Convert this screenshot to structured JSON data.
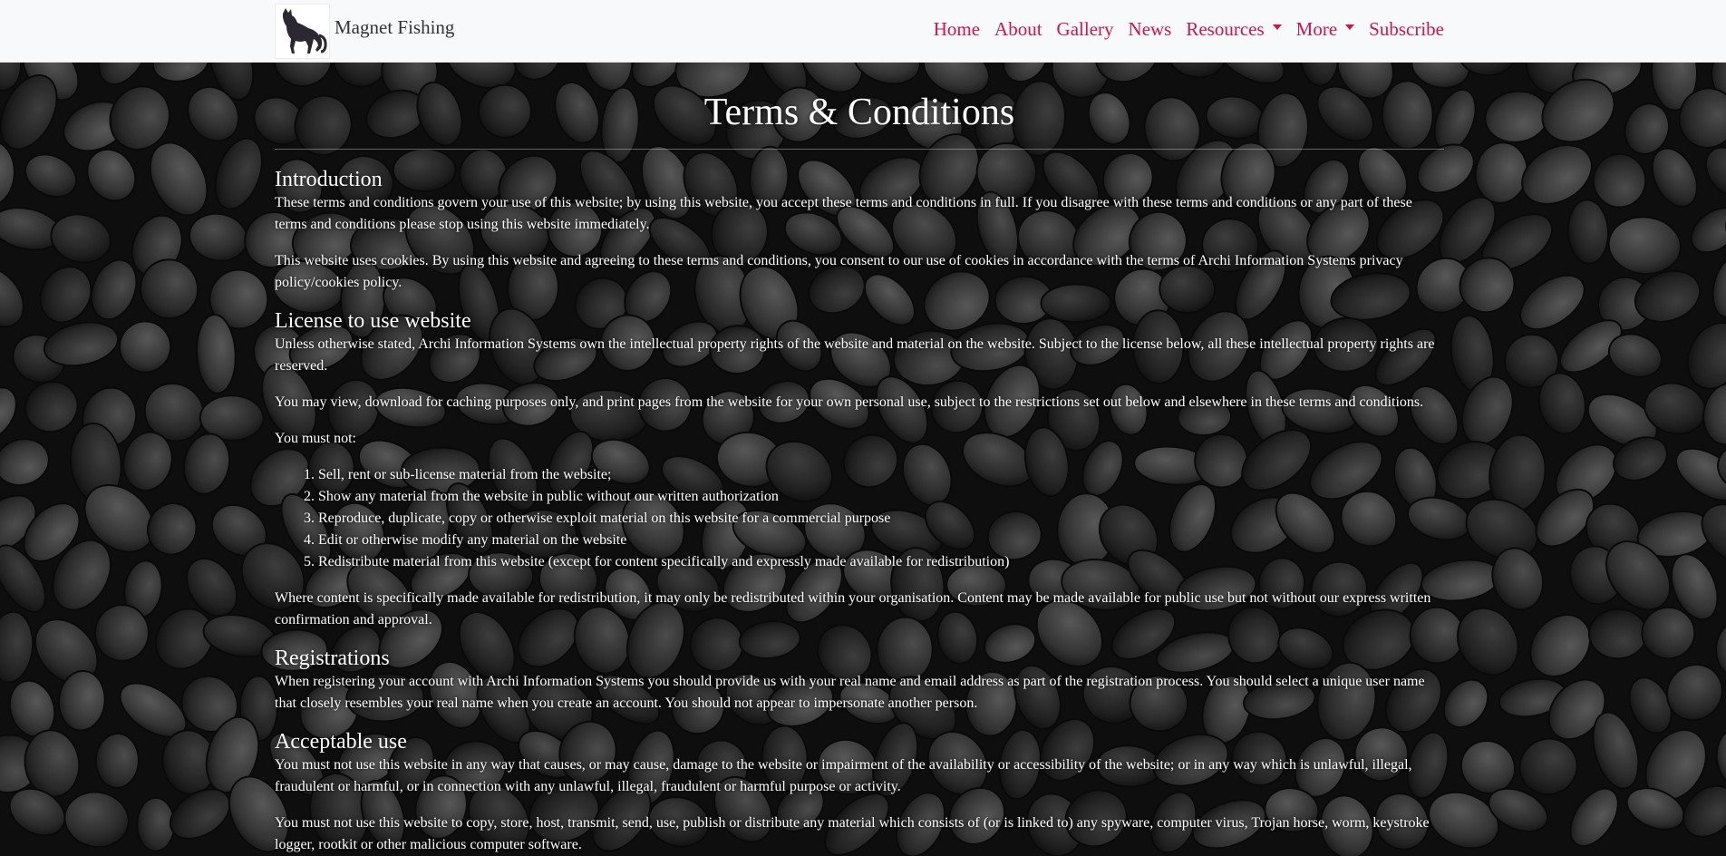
{
  "brand": {
    "name": "Magnet Fishing"
  },
  "nav": {
    "items": [
      {
        "label": "Home"
      },
      {
        "label": "About"
      },
      {
        "label": "Gallery"
      },
      {
        "label": "News"
      },
      {
        "label": "Resources",
        "dropdown": true
      },
      {
        "label": "More",
        "dropdown": true
      },
      {
        "label": "Subscribe"
      }
    ]
  },
  "colors": {
    "nav_link": "#d1134f",
    "navbar_bg": "#f8f9fa",
    "text": "#ffffff"
  },
  "page": {
    "title": "Terms & Conditions"
  },
  "sections": {
    "introduction": {
      "heading": "Introduction",
      "p1": "These terms and conditions govern your use of this website; by using this website, you accept these terms and conditions in full. If you disagree with these terms and conditions or any part of these terms and conditions please stop using this website immediately.",
      "p2": "This website uses cookies. By using this website and agreeing to these terms and conditions, you consent to our use of cookies in accordance with the terms of Archi Information Systems privacy policy/cookies policy."
    },
    "license": {
      "heading": "License to use website",
      "p1": "Unless otherwise stated, Archi Information Systems own the intellectual property rights of the website and material on the website. Subject to the license below, all these intellectual property rights are reserved.",
      "p2": "You may view, download for caching purposes only, and print pages from the website for your own personal use, subject to the restrictions set out below and elsewhere in these terms and conditions.",
      "p3": "You must not:",
      "list": [
        "Sell, rent or sub-license material from the website;",
        "Show any material from the website in public without our written authorization",
        "Reproduce, duplicate, copy or otherwise exploit material on this website for a commercial purpose",
        "Edit or otherwise modify any material on the website",
        "Redistribute material from this website (except for content specifically and expressly made available for redistribution)"
      ],
      "p4": "Where content is specifically made available for redistribution, it may only be redistributed within your organisation. Content may be made available for public use but not without our express written confirmation and approval."
    },
    "registrations": {
      "heading": "Registrations",
      "p1": "When registering your account with Archi Information Systems you should provide us with your real name and email address as part of the registration process. You should select a unique user name that closely resembles your real name when you create an account. You should not appear to impersonate another person."
    },
    "acceptable_use": {
      "heading": "Acceptable use",
      "p1": "You must not use this website in any way that causes, or may cause, damage to the website or impairment of the availability or accessibility of the website; or in any way which is unlawful, illegal, fraudulent or harmful, or in connection with any unlawful, illegal, fraudulent or harmful purpose or activity.",
      "p2": "You must not use this website to copy, store, host, transmit, send, use, publish or distribute any material which consists of (or is linked to) any spyware, computer virus, Trojan horse, worm, keystroke logger, rootkit or other malicious computer software."
    }
  }
}
